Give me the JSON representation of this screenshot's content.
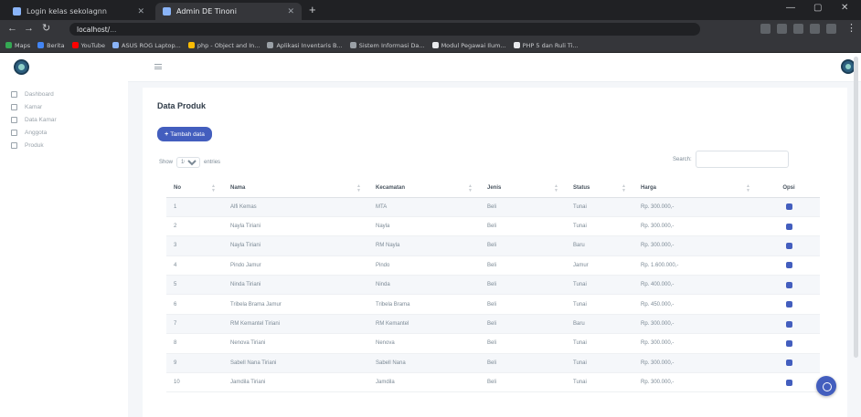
{
  "browser": {
    "tabs": [
      {
        "title": "Login kelas sekolagnn",
        "active": false
      },
      {
        "title": "Admin DE Tinoni",
        "active": true
      }
    ],
    "new_tab": "+",
    "url_host": "localhost/",
    "url_path": "...",
    "bookmarks": [
      {
        "label": "Maps",
        "color": "#34a853"
      },
      {
        "label": "Berita",
        "color": "#4285f4"
      },
      {
        "label": "YouTube",
        "color": "#ff0000"
      },
      {
        "label": "ASUS ROG Laptop...",
        "color": "#8ab4f8"
      },
      {
        "label": "php - Object and In...",
        "color": "#fbbc04"
      },
      {
        "label": "Aplikasi Inventaris B...",
        "color": "#9aa0a6"
      },
      {
        "label": "Sistem Informasi Da...",
        "color": "#9aa0a6"
      },
      {
        "label": "Modul Pegawai Ilum...",
        "color": "#e8eaed"
      },
      {
        "label": "PHP 5 dan Ruli Ti...",
        "color": "#e8eaed"
      }
    ]
  },
  "sidebar": {
    "logo_icon": "shield-logo",
    "items": [
      {
        "label": "Dashboard",
        "icon": "grid-icon"
      },
      {
        "label": "Kamar",
        "icon": "grid-icon"
      },
      {
        "label": "Data Kamar",
        "icon": "grid-icon"
      },
      {
        "label": "Anggota",
        "icon": "grid-icon"
      },
      {
        "label": "Produk",
        "icon": "grid-icon"
      }
    ]
  },
  "main": {
    "title": "Data Produk",
    "add_button": "Tambah data",
    "length_prefix": "Show",
    "length_value": "10",
    "length_suffix": "entries",
    "search_label": "Search:",
    "search_value": "",
    "columns": [
      "No",
      "Nama",
      "Kecamatan",
      "Jenis",
      "Status",
      "Harga",
      "Opsi"
    ],
    "rows": [
      [
        "1",
        "Alfi Kemas",
        "MTA",
        "Beli",
        "Tunai",
        "Rp. 300.000,-"
      ],
      [
        "2",
        "Nayla Tiriani",
        "Nayla",
        "Beli",
        "Tunai",
        "Rp. 300.000,-"
      ],
      [
        "3",
        "Nayla Tiriani",
        "RM Nayla",
        "Beli",
        "Baru",
        "Rp. 300.000,-"
      ],
      [
        "4",
        "Pindo Jamur",
        "Pindo",
        "Beli",
        "Jamur",
        "Rp. 1.600.000,-"
      ],
      [
        "5",
        "Ninda Tiriani",
        "Ninda",
        "Beli",
        "Tunai",
        "Rp. 400.000,-"
      ],
      [
        "6",
        "Tribela Brama Jamur",
        "Tribela Brama",
        "Beli",
        "Tunai",
        "Rp. 450.000,-"
      ],
      [
        "7",
        "RM Kemantel Tiriani",
        "RM Kemantel",
        "Beli",
        "Baru",
        "Rp. 300.000,-"
      ],
      [
        "8",
        "Nenova Tiriani",
        "Nenova",
        "Beli",
        "Tunai",
        "Rp. 300.000,-"
      ],
      [
        "9",
        "Sabell Nana Tiriani",
        "Sabell Nana",
        "Beli",
        "Tunai",
        "Rp. 300.000,-"
      ],
      [
        "10",
        "Jamdila Tiriani",
        "Jamdila",
        "Beli",
        "Tunai",
        "Rp. 300.000,-"
      ]
    ],
    "action_icon": "edit-icon"
  },
  "colors": {
    "accent": "#435ebe",
    "browser_dark": "#202124",
    "content_bg": "#f4f6f9"
  }
}
